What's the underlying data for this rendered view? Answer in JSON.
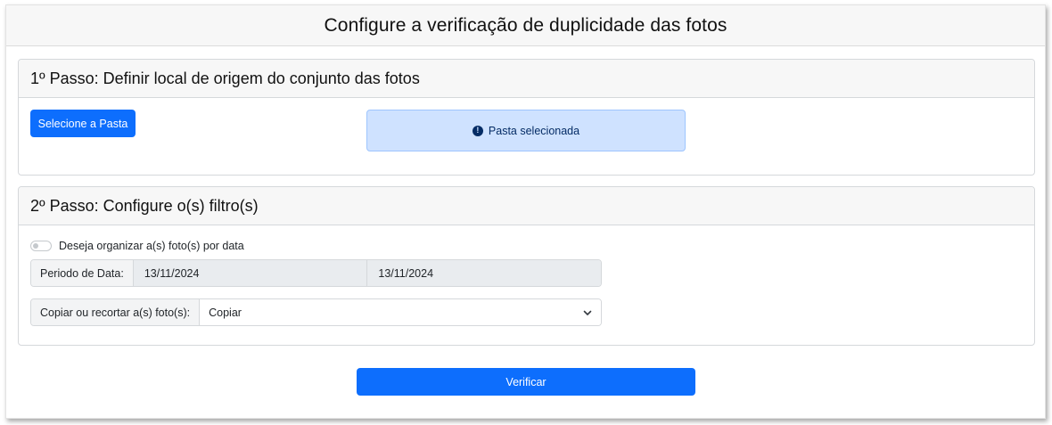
{
  "window": {
    "title": "Configure a verificação de duplicidade das fotos"
  },
  "step1": {
    "title": "1º Passo: Definir local de origem do conjunto das fotos",
    "select_folder_label": "Selecione a Pasta",
    "alert_icon": "exclamation-circle-icon",
    "alert_text": "Pasta selecionada"
  },
  "step2": {
    "title": "2º Passo: Configure o(s) filtro(s)",
    "organize_by_date_label": "Deseja organizar a(s) foto(s) por data",
    "organize_by_date_checked": false,
    "date_period_label": "Periodo de Data:",
    "date_start": "13/11/2024",
    "date_end": "13/11/2024",
    "copy_cut_label": "Copiar ou recortar a(s) foto(s):",
    "copy_cut_value": "Copiar"
  },
  "actions": {
    "verify_label": "Verificar"
  },
  "colors": {
    "primary": "#0d6efd",
    "alert_bg": "#cfe2ff",
    "alert_text": "#052c65"
  }
}
